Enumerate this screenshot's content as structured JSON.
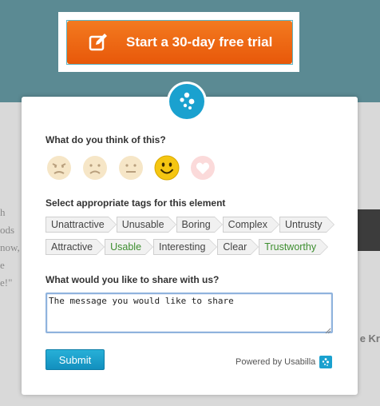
{
  "background": {
    "left_text": [
      "h",
      "ods",
      "now,",
      "",
      "e",
      "e!\""
    ],
    "right_text": "e Kr"
  },
  "cta": {
    "label": "Start a 30-day free trial",
    "icon": "edit-icon",
    "color": "#ee6a14"
  },
  "widget": {
    "logo_icon": "usabilla-logo-icon",
    "accent": "#1aa1cf",
    "emotion_question": "What do you think of this?",
    "emotions": [
      {
        "name": "angry",
        "selected": false
      },
      {
        "name": "sad",
        "selected": false
      },
      {
        "name": "neutral",
        "selected": false
      },
      {
        "name": "happy",
        "selected": true
      },
      {
        "name": "love",
        "selected": false
      }
    ],
    "tags_question": "Select appropriate tags for this element",
    "tags_row1": [
      "Unattractive",
      "Unusable",
      "Boring",
      "Complex",
      "Untrusty"
    ],
    "tags_row2": [
      {
        "label": "Attractive",
        "positive": false
      },
      {
        "label": "Usable",
        "positive": true
      },
      {
        "label": "Interesting",
        "positive": false
      },
      {
        "label": "Clear",
        "positive": false
      },
      {
        "label": "Trustworthy",
        "positive": true
      }
    ],
    "message_question": "What would you like to share with us?",
    "message_value": "The message you would like to share",
    "submit_label": "Submit",
    "powered_by": "Powered by Usabilla"
  }
}
